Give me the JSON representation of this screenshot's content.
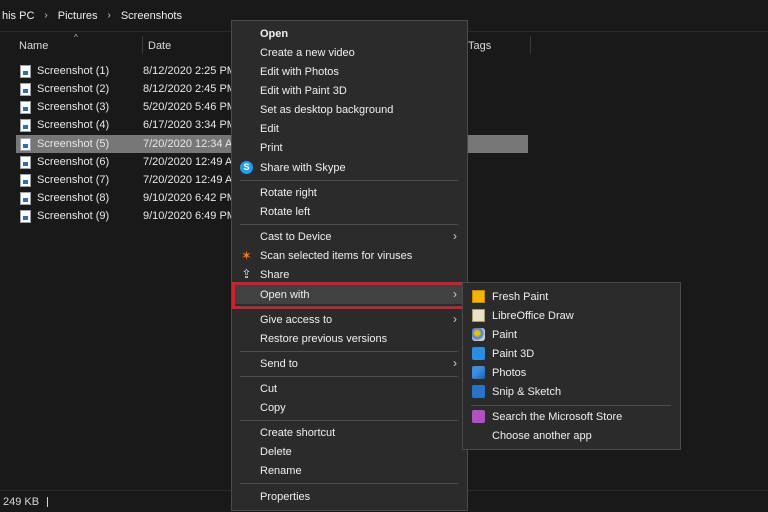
{
  "breadcrumb": [
    "his PC",
    "Pictures",
    "Screenshots"
  ],
  "columns": {
    "name": "Name",
    "date": "Date",
    "tags": "Tags"
  },
  "files": [
    {
      "name": "Screenshot (1)",
      "date": "8/12/2020 2:25 PM"
    },
    {
      "name": "Screenshot (2)",
      "date": "8/12/2020 2:45 PM"
    },
    {
      "name": "Screenshot (3)",
      "date": "5/20/2020 5:46 PM"
    },
    {
      "name": "Screenshot (4)",
      "date": "6/17/2020 3:34 PM"
    },
    {
      "name": "Screenshot (5)",
      "date": "7/20/2020 12:34 A"
    },
    {
      "name": "Screenshot (6)",
      "date": "7/20/2020 12:49 A"
    },
    {
      "name": "Screenshot (7)",
      "date": "7/20/2020 12:49 A"
    },
    {
      "name": "Screenshot (8)",
      "date": "9/10/2020 6:42 PM"
    },
    {
      "name": "Screenshot (9)",
      "date": "9/10/2020 6:49 PM"
    }
  ],
  "selected_file": "Screenshot (5)",
  "status": {
    "size": "249 KB"
  },
  "context_menu": {
    "open": "Open",
    "create_video": "Create a new video",
    "edit_photos": "Edit with Photos",
    "edit_paint3d": "Edit with Paint 3D",
    "set_desktop": "Set as desktop background",
    "edit": "Edit",
    "print": "Print",
    "share_skype": "Share with Skype",
    "rotate_right": "Rotate right",
    "rotate_left": "Rotate left",
    "cast": "Cast to Device",
    "scan": "Scan selected items for viruses",
    "share": "Share",
    "open_with": "Open with",
    "give_access": "Give access to",
    "restore": "Restore previous versions",
    "send_to": "Send to",
    "cut": "Cut",
    "copy": "Copy",
    "create_shortcut": "Create shortcut",
    "delete": "Delete",
    "rename": "Rename",
    "properties": "Properties"
  },
  "open_with_menu": {
    "fresh_paint": "Fresh Paint",
    "libreoffice_draw": "LibreOffice Draw",
    "paint": "Paint",
    "paint3d": "Paint 3D",
    "photos": "Photos",
    "snip_sketch": "Snip & Sketch",
    "search_store": "Search the Microsoft Store",
    "choose_app": "Choose another app"
  },
  "colors": {
    "highlight_border": "#d11f2e",
    "menu_bg": "#2b2b2b",
    "selected_row": "#777777"
  }
}
